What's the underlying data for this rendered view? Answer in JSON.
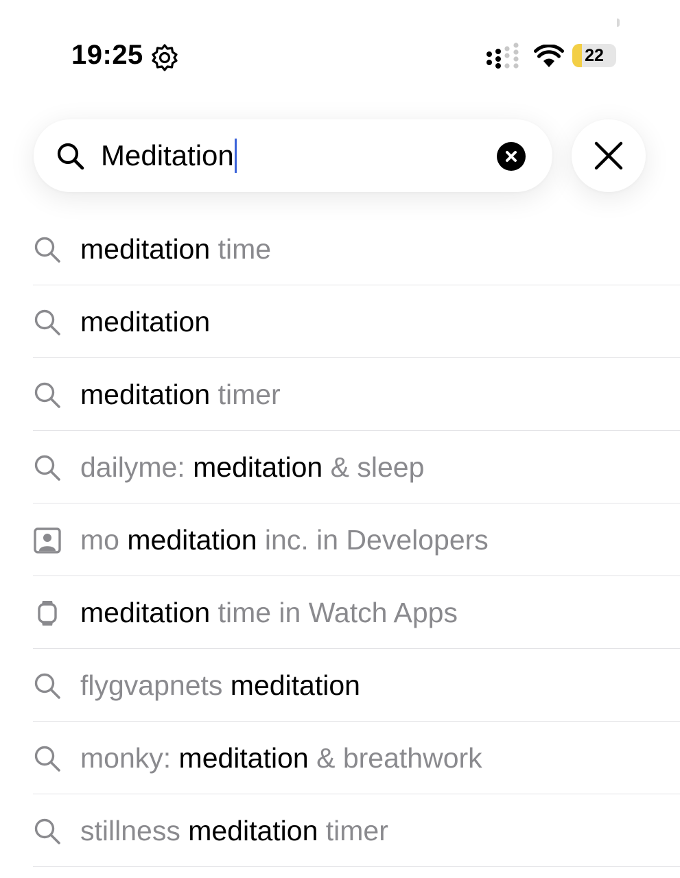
{
  "status_bar": {
    "time": "19:25",
    "status_icon": "gear-icon",
    "signal_icon": "cellular-signal-icon",
    "wifi_icon": "wifi-icon",
    "battery_level": "22",
    "battery_fill": 0.22,
    "battery_color": "#f3cf46"
  },
  "search": {
    "icon": "search-icon",
    "query": "Meditation",
    "clear_icon": "clear-icon",
    "cancel_icon": "close-icon"
  },
  "suggestions": [
    {
      "icon": "search-icon",
      "parts": [
        {
          "text": "meditation",
          "style": "bold"
        },
        {
          "text": " time",
          "style": "dim"
        }
      ]
    },
    {
      "icon": "search-icon",
      "parts": [
        {
          "text": "meditation",
          "style": "bold"
        }
      ]
    },
    {
      "icon": "search-icon",
      "parts": [
        {
          "text": "meditation",
          "style": "bold"
        },
        {
          "text": " timer",
          "style": "dim"
        }
      ]
    },
    {
      "icon": "search-icon",
      "parts": [
        {
          "text": "dailyme: ",
          "style": "dim"
        },
        {
          "text": "meditation",
          "style": "bold"
        },
        {
          "text": " & sleep",
          "style": "dim"
        }
      ]
    },
    {
      "icon": "developer-icon",
      "parts": [
        {
          "text": "mo ",
          "style": "dim"
        },
        {
          "text": "meditation",
          "style": "bold"
        },
        {
          "text": " inc. in Developers",
          "style": "dim"
        }
      ]
    },
    {
      "icon": "watch-icon",
      "parts": [
        {
          "text": "meditation",
          "style": "bold"
        },
        {
          "text": " time in Watch Apps",
          "style": "dim"
        }
      ]
    },
    {
      "icon": "search-icon",
      "parts": [
        {
          "text": "flygvapnets ",
          "style": "dim"
        },
        {
          "text": "meditation",
          "style": "bold"
        }
      ]
    },
    {
      "icon": "search-icon",
      "parts": [
        {
          "text": "monky: ",
          "style": "dim"
        },
        {
          "text": "meditation",
          "style": "bold"
        },
        {
          "text": " & breathwork",
          "style": "dim"
        }
      ]
    },
    {
      "icon": "search-icon",
      "parts": [
        {
          "text": "stillness ",
          "style": "dim"
        },
        {
          "text": "meditation",
          "style": "bold"
        },
        {
          "text": " timer",
          "style": "dim"
        }
      ]
    }
  ],
  "colors": {
    "primary_text": "#000000",
    "secondary_text": "#8a8a8e",
    "separator": "#e3e3e6",
    "caret": "#3a62d9"
  }
}
